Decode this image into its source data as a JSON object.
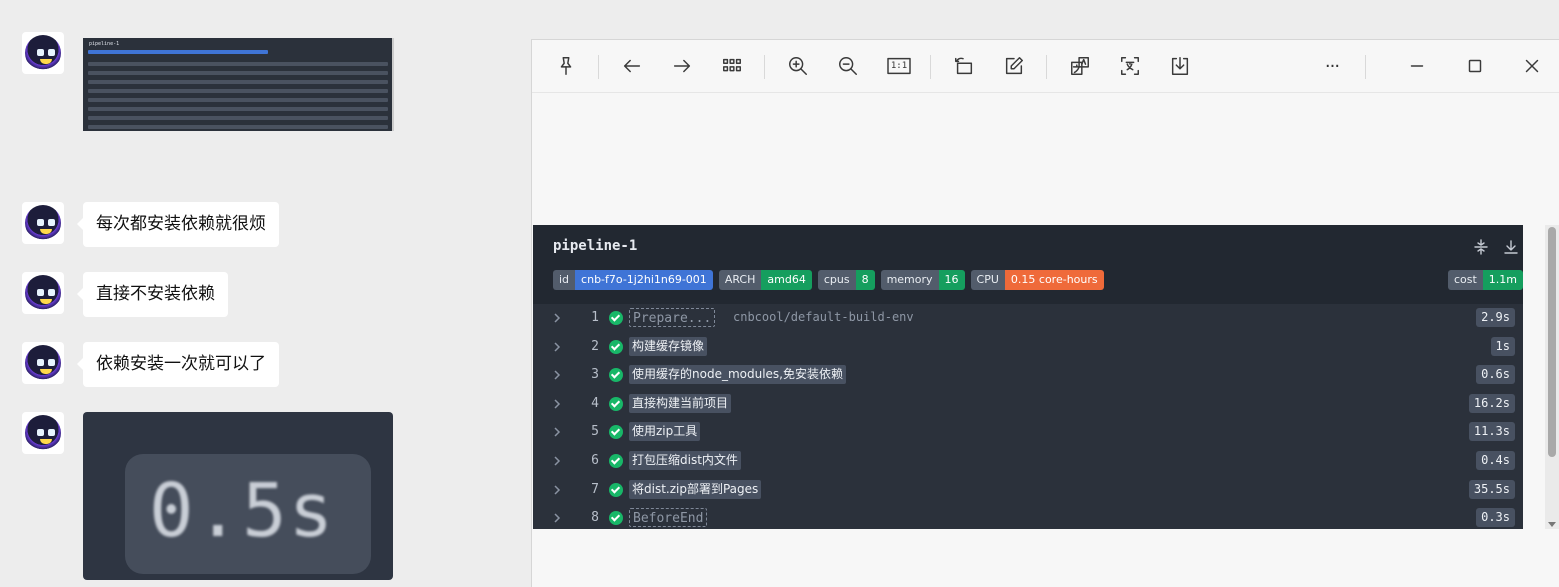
{
  "chat": {
    "messages": [
      "每次都安装依赖就很烦",
      "直接不安装依赖",
      "依赖安装一次就可以了"
    ],
    "zoom_text": "0.5s",
    "thumbnail_title": "pipeline-1"
  },
  "viewer": {
    "toolbar": [
      "pin-icon",
      "back-icon",
      "forward-icon",
      "grid-icon",
      "zoom-in-icon",
      "zoom-out-icon",
      "actual-size-icon",
      "rotate-icon",
      "edit-icon",
      "translate-icon",
      "ocr-icon",
      "download-icon",
      "more-icon",
      "minimize-icon",
      "maximize-icon",
      "close-icon"
    ],
    "actual_size_label": "1:1",
    "more_label": "···"
  },
  "pipeline": {
    "title": "pipeline-1",
    "badges": [
      {
        "key": "id",
        "value": "cnb-f7o-1j2hi1n69-001",
        "color": "#3f74d6"
      },
      {
        "key": "ARCH",
        "value": "amd64",
        "color": "#159e5e"
      },
      {
        "key": "cpus",
        "value": "8",
        "color": "#159e5e"
      },
      {
        "key": "memory",
        "value": "16",
        "color": "#159e5e"
      },
      {
        "key": "CPU",
        "value": "0.15 core-hours",
        "color": "#ef6a3a"
      }
    ],
    "cost": {
      "key": "cost",
      "value": "1.1m",
      "color": "#159e5e"
    },
    "steps": [
      {
        "num": "1",
        "name": "Prepare...",
        "dashed": true,
        "extra": "cnbcool/default-build-env",
        "duration": "2.9s"
      },
      {
        "num": "2",
        "name": "构建缓存镜像",
        "dashed": false,
        "extra": "",
        "duration": "1s"
      },
      {
        "num": "3",
        "name": "使用缓存的node_modules,免安装依赖",
        "dashed": false,
        "extra": "",
        "duration": "0.6s"
      },
      {
        "num": "4",
        "name": "直接构建当前项目",
        "dashed": false,
        "extra": "",
        "duration": "16.2s"
      },
      {
        "num": "5",
        "name": "使用zip工具",
        "dashed": false,
        "extra": "",
        "duration": "11.3s"
      },
      {
        "num": "6",
        "name": "打包压缩dist内文件",
        "dashed": false,
        "extra": "",
        "duration": "0.4s"
      },
      {
        "num": "7",
        "name": "将dist.zip部署到Pages",
        "dashed": false,
        "extra": "",
        "duration": "35.5s"
      },
      {
        "num": "8",
        "name": "BeforeEnd",
        "dashed": true,
        "extra": "",
        "duration": "0.3s"
      }
    ]
  }
}
